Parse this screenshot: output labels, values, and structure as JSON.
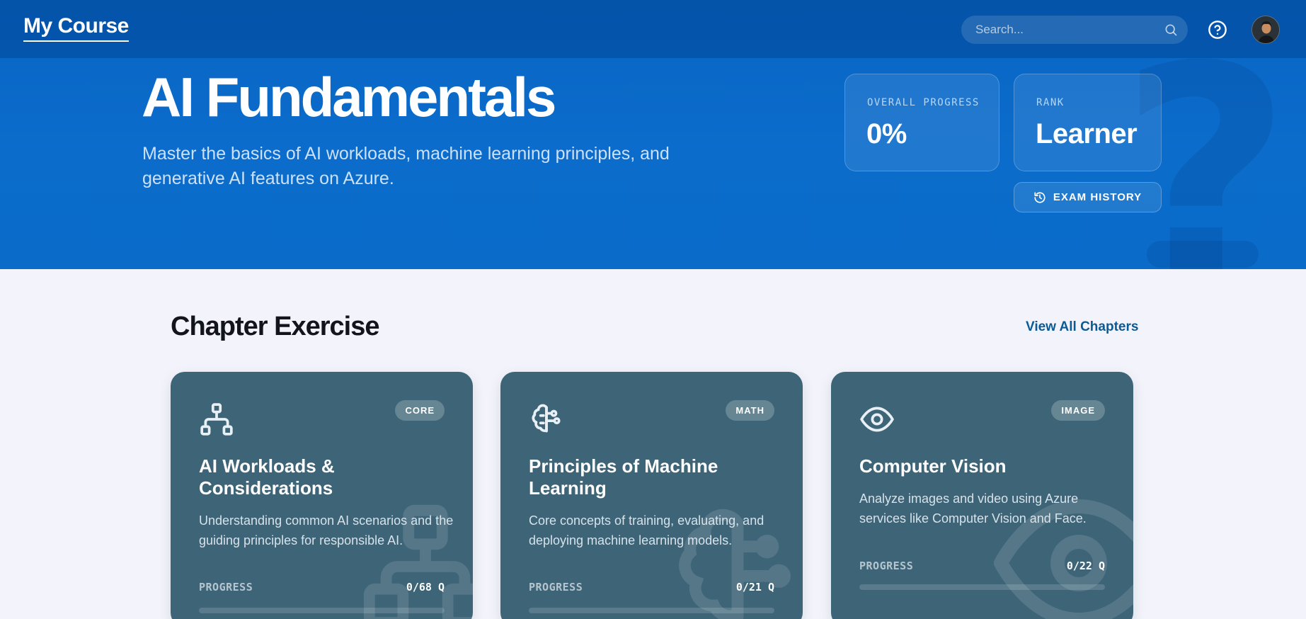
{
  "header": {
    "brand": "My Course",
    "search_placeholder": "Search...",
    "search_icon": "search-icon",
    "help_icon": "help-circle-icon",
    "avatar_icon": "user-avatar"
  },
  "hero": {
    "title": "AI Fundamentals",
    "subtitle": "Master the basics of AI workloads, machine learning principles, and generative AI features on Azure.",
    "stats": {
      "overall_progress_label": "OVERALL PROGRESS",
      "overall_progress_value": "0%",
      "rank_label": "RANK",
      "rank_value": "Learner"
    },
    "exam_history_label": "EXAM HISTORY",
    "exam_history_icon": "history-icon"
  },
  "section": {
    "title": "Chapter Exercise",
    "view_all_label": "View All Chapters"
  },
  "chapters": [
    {
      "icon": "sitemap-icon",
      "badge": "CORE",
      "title": "AI Workloads & Considerations",
      "description": "Understanding common AI scenarios and the guiding principles for responsible AI.",
      "progress_label": "PROGRESS",
      "progress_count": "0/68 Q",
      "progress_fraction": 0
    },
    {
      "icon": "brain-circuit-icon",
      "badge": "MATH",
      "title": "Principles of Machine Learning",
      "description": "Core concepts of training, evaluating, and deploying machine learning models.",
      "progress_label": "PROGRESS",
      "progress_count": "0/21 Q",
      "progress_fraction": 0
    },
    {
      "icon": "eye-icon",
      "badge": "IMAGE",
      "title": "Computer Vision",
      "description": "Analyze images and video using Azure services like Computer Vision and Face.",
      "progress_label": "PROGRESS",
      "progress_count": "0/22 Q",
      "progress_fraction": 0
    }
  ],
  "colors": {
    "hero_blue": "#0a66c4",
    "card_bg": "#3d6477",
    "link": "#0b5a96",
    "page_bg": "#f3f4fb"
  }
}
